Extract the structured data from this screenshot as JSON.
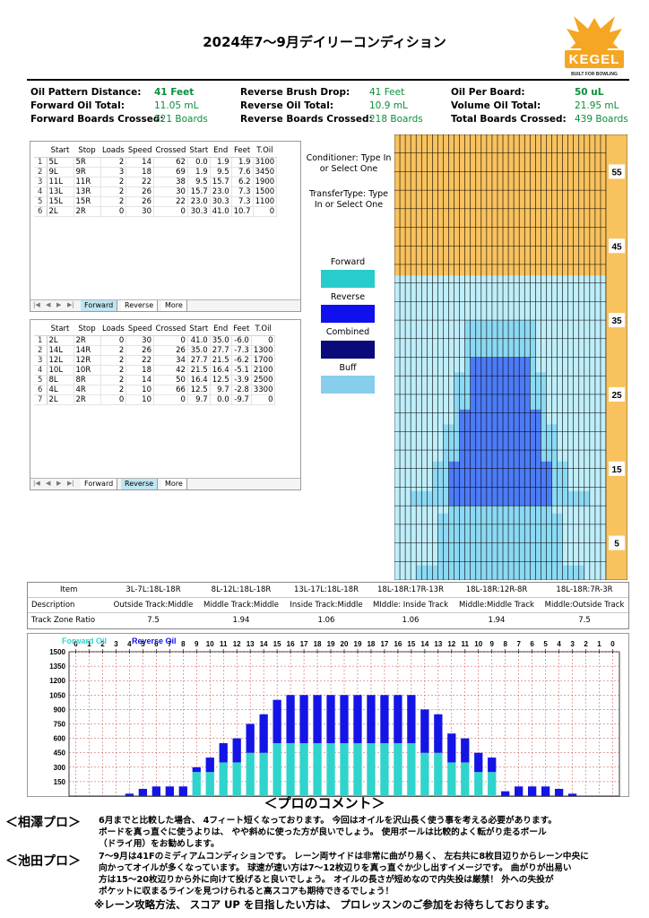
{
  "title": "2024年7～9月デイリーコンディション",
  "logo": {
    "text": "KEGEL",
    "tagline": "BUILT FOR BOWLING",
    "color": "#f5a623"
  },
  "summary": [
    [
      {
        "label": "Oil Pattern Distance:",
        "value": "41 Feet",
        "bold": true
      },
      {
        "label": "Reverse Brush Drop:",
        "value": "41 Feet"
      },
      {
        "label": "Oil Per Board:",
        "value": "50 uL",
        "bold": true
      }
    ],
    [
      {
        "label": "Forward Oil Total:",
        "value": "11.05 mL"
      },
      {
        "label": "Reverse Oil Total:",
        "value": "10.9 mL"
      },
      {
        "label": "Volume Oil Total:",
        "value": "21.95 mL"
      }
    ],
    [
      {
        "label": "Forward Boards Crossed:",
        "value": "221 Boards"
      },
      {
        "label": "Reverse Boards Crossed:",
        "value": "218 Boards"
      },
      {
        "label": "Total Boards Crossed:",
        "value": "439 Boards"
      }
    ]
  ],
  "columns": [
    "Start",
    "Stop",
    "Loads",
    "Speed",
    "Crossed",
    "Start",
    "End",
    "Feet",
    "T.Oil"
  ],
  "forward_table": [
    [
      "1",
      "5L",
      "5R",
      "2",
      "14",
      "62",
      "0.0",
      "1.9",
      "1.9",
      "3100"
    ],
    [
      "2",
      "9L",
      "9R",
      "3",
      "18",
      "69",
      "1.9",
      "9.5",
      "7.6",
      "3450"
    ],
    [
      "3",
      "11L",
      "11R",
      "2",
      "22",
      "38",
      "9.5",
      "15.7",
      "6.2",
      "1900"
    ],
    [
      "4",
      "13L",
      "13R",
      "2",
      "26",
      "30",
      "15.7",
      "23.0",
      "7.3",
      "1500"
    ],
    [
      "5",
      "15L",
      "15R",
      "2",
      "26",
      "22",
      "23.0",
      "30.3",
      "7.3",
      "1100"
    ],
    [
      "6",
      "2L",
      "2R",
      "0",
      "30",
      "0",
      "30.3",
      "41.0",
      "10.7",
      "0"
    ]
  ],
  "reverse_table": [
    [
      "1",
      "2L",
      "2R",
      "0",
      "30",
      "0",
      "41.0",
      "35.0",
      "-6.0",
      "0"
    ],
    [
      "2",
      "14L",
      "14R",
      "2",
      "26",
      "26",
      "35.0",
      "27.7",
      "-7.3",
      "1300"
    ],
    [
      "3",
      "12L",
      "12R",
      "2",
      "22",
      "34",
      "27.7",
      "21.5",
      "-6.2",
      "1700"
    ],
    [
      "4",
      "10L",
      "10R",
      "2",
      "18",
      "42",
      "21.5",
      "16.4",
      "-5.1",
      "2100"
    ],
    [
      "5",
      "8L",
      "8R",
      "2",
      "14",
      "50",
      "16.4",
      "12.5",
      "-3.9",
      "2500"
    ],
    [
      "6",
      "4L",
      "4R",
      "2",
      "10",
      "66",
      "12.5",
      "9.7",
      "-2.8",
      "3300"
    ],
    [
      "7",
      "2L",
      "2R",
      "0",
      "10",
      "0",
      "9.7",
      "0.0",
      "-9.7",
      "0"
    ]
  ],
  "tabs": [
    "Forward",
    "Reverse",
    "More"
  ],
  "nav_icons": [
    "first-icon",
    "prev-icon",
    "next-icon",
    "last-icon"
  ],
  "conditioner": "Conditioner: Type In or Select One",
  "transfer": "TransferType: Type In or Select One",
  "legend": [
    {
      "label": "Forward",
      "color": "#29cccc"
    },
    {
      "label": "Reverse",
      "color": "#1010ee"
    },
    {
      "label": "Combined",
      "color": "#0a0a7a"
    },
    {
      "label": "Buff",
      "color": "#87cdec"
    }
  ],
  "lane": {
    "feet_labels": [
      "55",
      "45",
      "35",
      "25",
      "15",
      "5"
    ],
    "wood_color": "#f8c25e",
    "pattern_length_ft": 41,
    "lane_length_ft": 60
  },
  "zone": {
    "row_labels": [
      "Item",
      "Description",
      "Track Zone Ratio"
    ],
    "columns": [
      {
        "item": "3L-7L:18L-18R",
        "desc": "Outside Track:Middle",
        "ratio": "7.5"
      },
      {
        "item": "8L-12L:18L-18R",
        "desc": "Middle Track:Middle",
        "ratio": "1.94"
      },
      {
        "item": "13L-17L:18L-18R",
        "desc": "Inside Track:Middle",
        "ratio": "1.06"
      },
      {
        "item": "18L-18R:17R-13R",
        "desc": "MIddle: Inside Track",
        "ratio": "1.06"
      },
      {
        "item": "18L-18R:12R-8R",
        "desc": "Middle:Middle Track",
        "ratio": "1.94"
      },
      {
        "item": "18L-18R:7R-3R",
        "desc": "Middle:Outside Track",
        "ratio": "7.5"
      }
    ]
  },
  "chart_data": {
    "type": "bar",
    "categories": [
      "0",
      "1",
      "2",
      "3",
      "4",
      "5",
      "6",
      "7",
      "8",
      "9",
      "10",
      "11",
      "12",
      "13",
      "14",
      "15",
      "16",
      "17",
      "18",
      "19",
      "20",
      "19",
      "18",
      "17",
      "16",
      "15",
      "14",
      "13",
      "12",
      "11",
      "10",
      "9",
      "8",
      "7",
      "6",
      "5",
      "4",
      "3",
      "2",
      "1",
      "0"
    ],
    "series": [
      {
        "name": "Forward Oil",
        "color": "#2fd4cc",
        "values": [
          0,
          0,
          0,
          0,
          0,
          0,
          0,
          0,
          0,
          250,
          250,
          350,
          350,
          450,
          450,
          550,
          550,
          550,
          550,
          550,
          550,
          550,
          550,
          550,
          550,
          550,
          450,
          450,
          350,
          350,
          250,
          250,
          0,
          0,
          0,
          0,
          0,
          0,
          0,
          0,
          0
        ]
      },
      {
        "name": "Reverse Oil",
        "color": "#1414e6",
        "values": [
          0,
          0,
          0,
          0,
          25,
          75,
          100,
          100,
          100,
          50,
          150,
          200,
          250,
          300,
          400,
          450,
          500,
          500,
          500,
          500,
          500,
          500,
          500,
          500,
          500,
          500,
          450,
          400,
          300,
          250,
          200,
          150,
          50,
          100,
          100,
          100,
          75,
          25,
          0,
          0,
          0
        ]
      }
    ],
    "ylim": [
      0,
      1500
    ],
    "yticks": [
      150,
      300,
      450,
      600,
      750,
      900,
      1050,
      1200,
      1350,
      1500
    ],
    "grid": true,
    "legend_position": "top-left"
  },
  "comments": {
    "title": "＜プロのコメント＞",
    "items": [
      {
        "name": "＜相澤プロ＞",
        "lines": [
          "6月までと比較した場合、 4フィート短くなっております。 今回はオイルを沢山長く使う事を考える必要があります。",
          "ボードを真っ直ぐに使うよりは、 やや斜めに使った方が良いでしょう。 使用ボールは比較的よく転がり走るボール",
          "（ドライ用）をお勧めします。"
        ]
      },
      {
        "name": "＜池田プロ＞",
        "lines": [
          "7～9月は41Fのミディアムコンディションです。 レーン両サイドは非常に曲がり易く、 左右共に8枚目辺りからレーン中央に",
          "向かってオイルが多くなっています。 球速が速い方は7～12枚辺りを真っ直ぐか少し出すイメージです。 曲がりが出易い",
          "方は15～20枚辺りから外に向けて投げると良いでしょう。 オイルの長さが短めなので内失投は厳禁！ 外への失投が",
          "ポケットに収まるラインを見つけられると高スコアも期待できるでしょう！"
        ]
      }
    ],
    "footer": "※レーン攻略方法、 スコア UP を目指したい方は、 プロレッスンのご参加をお待ちしております。"
  }
}
